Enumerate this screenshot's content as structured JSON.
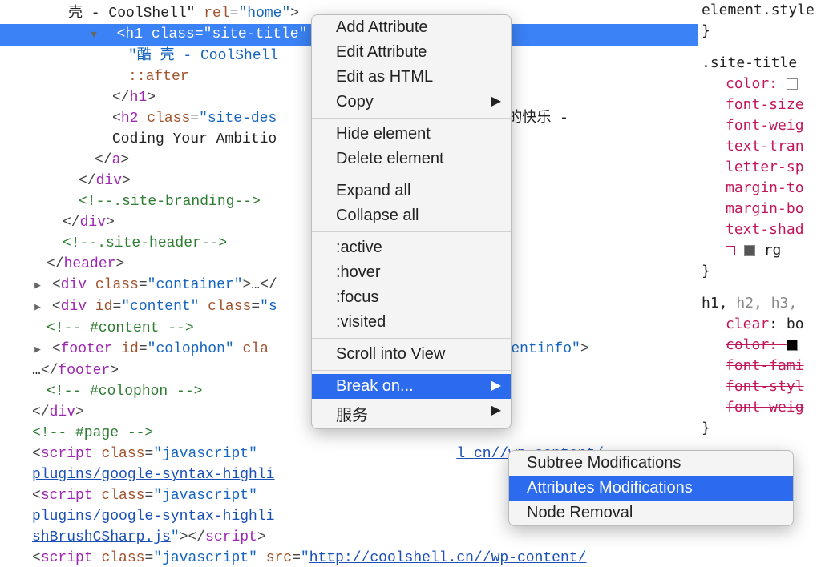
{
  "code_lines": [
    {
      "indent": 85,
      "html": "<span class='txt'>壳 - CoolShell\"</span> <span class='attr'>rel</span><span class='punc'>=</span><span class='str'>\"home\"</span><span class='punc'>&gt;</span>"
    },
    {
      "indent": 110,
      "hl": true,
      "html": "<span class='arrow down'></span>  <span class='punc'>&lt;</span><span class='tag'>h1</span> <span class='attr'>class</span><span class='punc'>=</span><span class='str'>\"site-title\"</span>"
    },
    {
      "indent": 160,
      "html": "<span class='str'>\"酷 壳 - CoolShell</span>"
    },
    {
      "indent": 160,
      "html": "<span class='pseudo'>::after</span>"
    },
    {
      "indent": 140,
      "html": "<span class='punc'>&lt;/</span><span class='tag'>h1</span><span class='punc'>&gt;</span>"
    },
    {
      "indent": 140,
      "html": "<span class='punc'>&lt;</span><span class='tag'>h2</span> <span class='attr'>class</span><span class='punc'>=</span><span class='str'>\"site-des</span>                    <span class='txt'>术所带来的快乐 - </span>"
    },
    {
      "indent": 140,
      "html": "<span class='txt'>Coding Your Ambitio</span>"
    },
    {
      "indent": 118,
      "html": "<span class='punc'>&lt;/</span><span class='tag'>a</span><span class='punc'>&gt;</span>"
    },
    {
      "indent": 98,
      "html": "<span class='punc'>&lt;/</span><span class='tag'>div</span><span class='punc'>&gt;</span>"
    },
    {
      "indent": 98,
      "html": "<span class='comment'>&lt;!--.site-branding--&gt;</span>"
    },
    {
      "indent": 78,
      "html": "<span class='punc'>&lt;/</span><span class='tag'>div</span><span class='punc'>&gt;</span>"
    },
    {
      "indent": 78,
      "html": "<span class='comment'>&lt;!--.site-header--&gt;</span>"
    },
    {
      "indent": 58,
      "html": "<span class='punc'>&lt;/</span><span class='tag'>header</span><span class='punc'>&gt;</span>"
    },
    {
      "indent": 40,
      "html": "<span class='arrow right'></span> <span class='punc'>&lt;</span><span class='tag'>div</span> <span class='attr'>class</span><span class='punc'>=</span><span class='str'>\"container\"</span><span class='punc'>&gt;…&lt;/</span>"
    },
    {
      "indent": 40,
      "html": "<span class='arrow right'></span> <span class='punc'>&lt;</span><span class='tag'>div</span> <span class='attr'>id</span><span class='punc'>=</span><span class='str'>\"content\"</span> <span class='attr'>class</span><span class='punc'>=</span><span class='str'>\"s</span>"
    },
    {
      "indent": 58,
      "html": "<span class='comment'>&lt;!-- #content --&gt;</span>"
    },
    {
      "indent": 40,
      "html": "<span class='arrow right'></span> <span class='punc'>&lt;</span><span class='tag'>footer</span> <span class='attr'>id</span><span class='punc'>=</span><span class='str'>\"colophon\"</span> <span class='attr'>cla</span>                      <span class='punc'>=</span><span class='str'>\"contentinfo\"</span><span class='punc'>&gt;</span>"
    },
    {
      "indent": 40,
      "html": "<span class='txt'>…</span><span class='punc'>&lt;/</span><span class='tag'>footer</span><span class='punc'>&gt;</span>"
    },
    {
      "indent": 58,
      "html": "<span class='comment'>&lt;!-- #colophon --&gt;</span>"
    },
    {
      "indent": 40,
      "html": "<span class='punc'>&lt;/</span><span class='tag'>div</span><span class='punc'>&gt;</span>"
    },
    {
      "indent": 40,
      "html": "<span class='comment'>&lt;!-- #page --&gt;</span>"
    },
    {
      "indent": 40,
      "html": "<span class='punc'>&lt;</span><span class='tag'>script</span> <span class='attr'>class</span><span class='punc'>=</span><span class='str'>\"javascript\"</span>                       <span class='link'>l cn//wp-content/</span>"
    },
    {
      "indent": 40,
      "html": "<span class='link'>plugins/google-syntax-highli</span>"
    },
    {
      "indent": 40,
      "html": "<span class='punc'>&lt;</span><span class='tag'>script</span> <span class='attr'>class</span><span class='punc'>=</span><span class='str'>\"javascript\"</span>"
    },
    {
      "indent": 40,
      "html": "<span class='link'>plugins/google-syntax-highli</span>"
    },
    {
      "indent": 40,
      "html": "<span class='link'>shBrushCSharp.js</span><span class='str'>\"</span><span class='punc'>&gt;&lt;/</span><span class='tag'>script</span><span class='punc'>&gt;</span>"
    },
    {
      "indent": 40,
      "html": "<span class='punc'>&lt;</span><span class='tag'>script</span> <span class='attr'>class</span><span class='punc'>=</span><span class='str'>\"javascript\"</span> <span class='attr'>src</span><span class='punc'>=</span><span class='str'>\"</span><span class='link'>http://coolshell.cn//wp-content/</span>"
    }
  ],
  "context_menu": {
    "groups": [
      [
        "Add Attribute",
        "Edit Attribute",
        "Edit as HTML",
        {
          "label": "Copy",
          "sub": true
        }
      ],
      [
        "Hide element",
        "Delete element"
      ],
      [
        "Expand all",
        "Collapse all"
      ],
      [
        ":active",
        ":hover",
        ":focus",
        ":visited"
      ],
      [
        "Scroll into View"
      ],
      [
        {
          "label": "Break on...",
          "sub": true,
          "sel": true
        },
        {
          "label": "服务",
          "sub": true
        }
      ]
    ]
  },
  "sub_menu": [
    {
      "label": "Subtree Modifications"
    },
    {
      "label": "Attributes Modifications",
      "sel": true
    },
    {
      "label": "Node Removal"
    }
  ],
  "styles": {
    "element_style": "element.style",
    "site_title_sel": ".site-title",
    "site_title_props": [
      "color",
      "font-size",
      "font-weig",
      "text-tran",
      "letter-sp",
      "margin-to",
      "margin-bo",
      "text-shad"
    ],
    "rgb_prefix": "rg",
    "h_sel_active": "h1,",
    "h_sel_gray": " h2, h3,",
    "clear_label": "clear",
    "clear_val": "bo",
    "strike_props": [
      "color",
      "font-fami",
      "font-styl",
      "font-weig"
    ],
    "margin_t": "margin-t"
  }
}
